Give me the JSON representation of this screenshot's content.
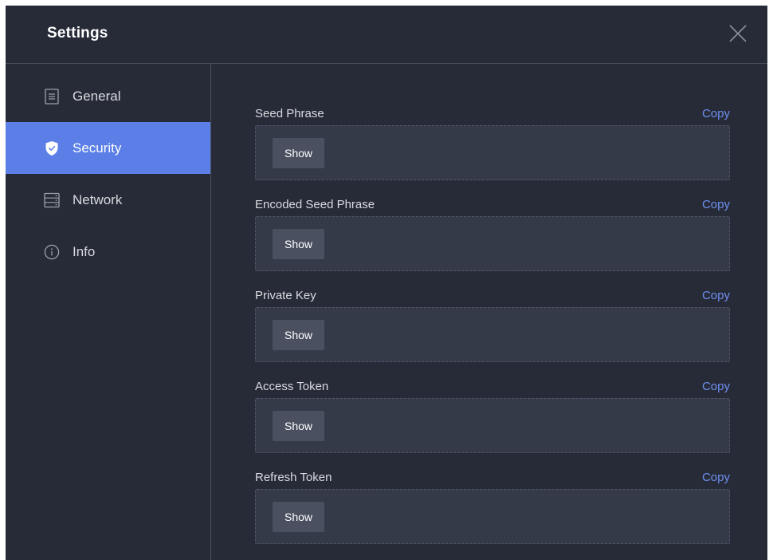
{
  "header": {
    "title": "Settings"
  },
  "sidebar": {
    "items": [
      {
        "label": "General",
        "icon": "document-icon",
        "active": false
      },
      {
        "label": "Security",
        "icon": "shield-icon",
        "active": true
      },
      {
        "label": "Network",
        "icon": "server-icon",
        "active": false
      },
      {
        "label": "Info",
        "icon": "info-icon",
        "active": false
      }
    ]
  },
  "fields": [
    {
      "label": "Seed Phrase",
      "copy_label": "Copy",
      "show_label": "Show"
    },
    {
      "label": "Encoded Seed Phrase",
      "copy_label": "Copy",
      "show_label": "Show"
    },
    {
      "label": "Private Key",
      "copy_label": "Copy",
      "show_label": "Show"
    },
    {
      "label": "Access Token",
      "copy_label": "Copy",
      "show_label": "Show"
    },
    {
      "label": "Refresh Token",
      "copy_label": "Copy",
      "show_label": "Show"
    }
  ],
  "colors": {
    "background": "#272b38",
    "accent": "#5b7fe6",
    "link": "#6e8ff0",
    "field_bg": "#353a49",
    "button_bg": "#4a5060"
  }
}
